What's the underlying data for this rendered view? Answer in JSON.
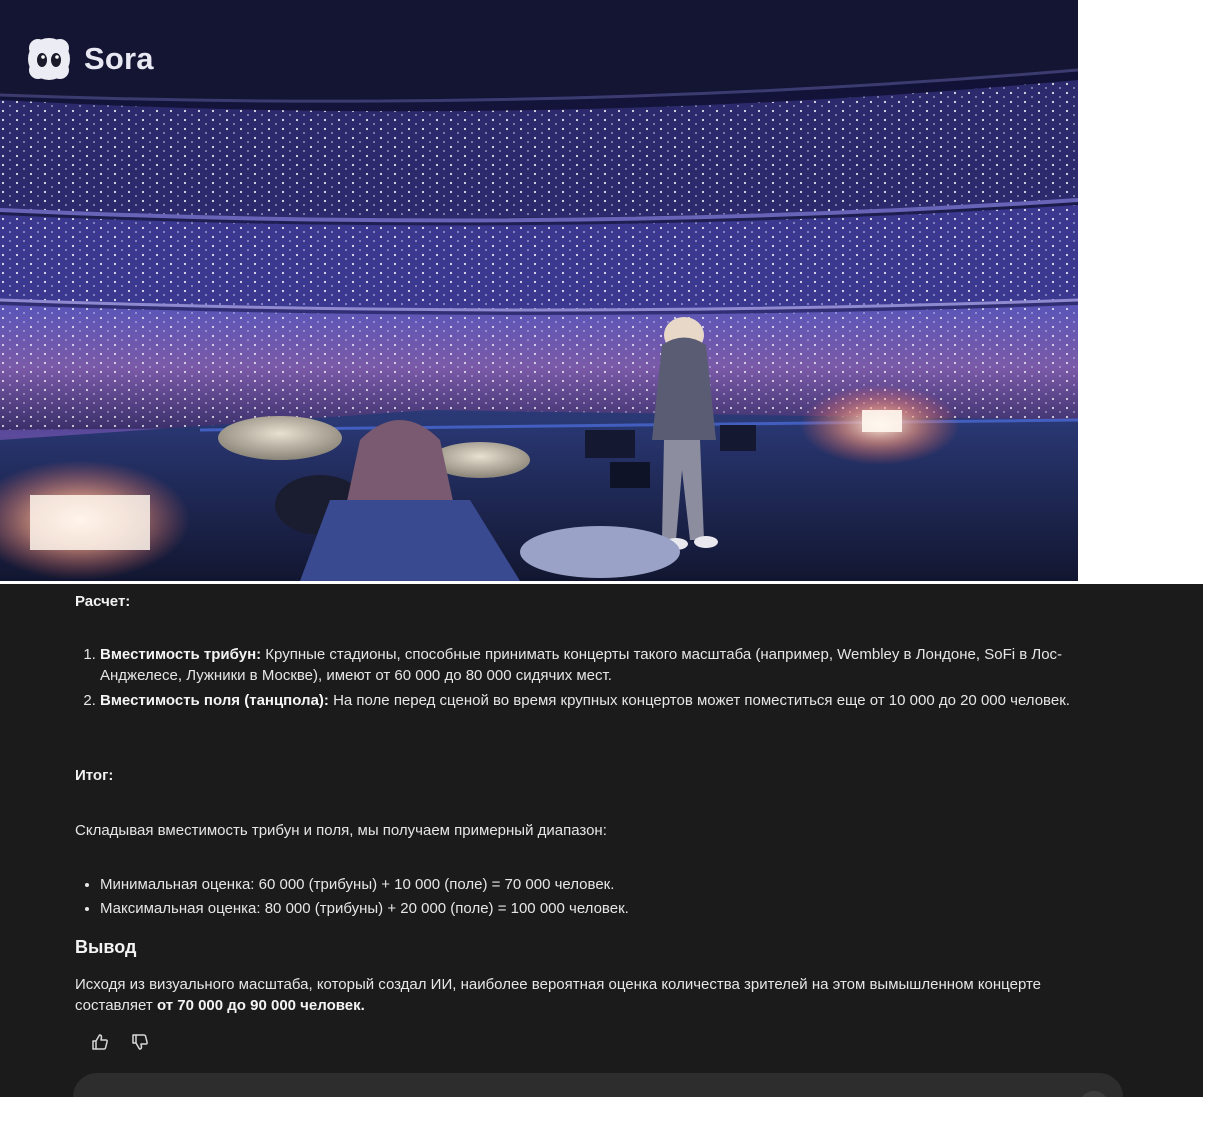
{
  "video": {
    "logo_text": "Sora",
    "icon": "sora-logo-icon"
  },
  "message": {
    "calc_heading": "Расчет:",
    "calc_items": [
      {
        "label": "Вместимость трибун:",
        "text": " Крупные стадионы, способные принимать концерты такого масштаба (например, Wembley в Лондоне, SoFi в Лос-Анджелесе, Лужники в Москве), имеют от 60 000 до 80 000 сидячих мест."
      },
      {
        "label": "Вместимость поля (танцпола):",
        "text": " На поле перед сценой во время крупных концертов может поместиться еще от 10 000 до 20 000 человек."
      }
    ],
    "total_heading": "Итог:",
    "total_intro": "Складывая вместимость трибун и поля, мы получаем примерный диапазон:",
    "estimates": [
      "Минимальная оценка: 60 000 (трибуны) + 10 000 (поле) = 70 000 человек.",
      "Максимальная оценка: 80 000 (трибуны) + 20 000 (поле) = 100 000 человек."
    ],
    "conclusion_heading": "Вывод",
    "conclusion_text": "Исходя из визуального масштаба, который создал ИИ, наиболее вероятная оценка количества зрителей на этом вымышленном концерте составляет ",
    "conclusion_bold": "от 70 000 до 90 000 человек."
  },
  "actions": {
    "like_icon": "thumbs-up-icon",
    "dislike_icon": "thumbs-down-icon"
  },
  "colors": {
    "panel_bg": "#1b1b1b",
    "text": "#e6e6e6",
    "composer_bg": "#2d2d2d"
  }
}
